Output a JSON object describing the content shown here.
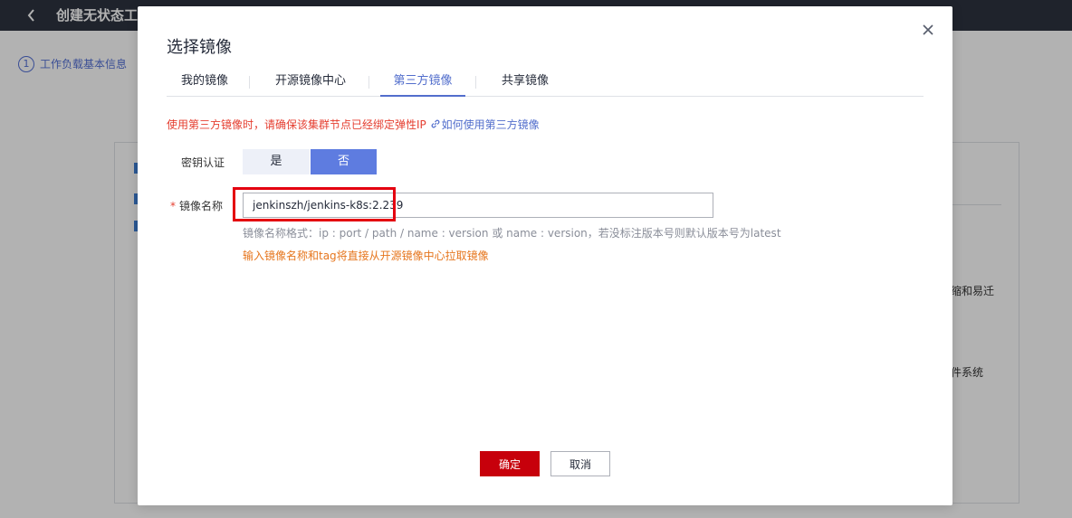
{
  "background": {
    "page_title": "创建无状态工",
    "step_number": "1",
    "step_label": "工作负载基本信息",
    "side_text_1": "缩和易迁",
    "side_text_2": "件系统"
  },
  "modal": {
    "title": "选择镜像",
    "tabs": [
      {
        "label": "我的镜像"
      },
      {
        "label": "开源镜像中心"
      },
      {
        "label": "第三方镜像"
      },
      {
        "label": "共享镜像"
      }
    ],
    "active_tab": "第三方镜像",
    "warning_text": "使用第三方镜像时，请确保该集群节点已经绑定弹性IP",
    "help_link": "如何使用第三方镜像",
    "key_auth": {
      "label": "密钥认证",
      "yes": "是",
      "no": "否",
      "selected": "否"
    },
    "image_name": {
      "required_mark": "*",
      "label": "镜像名称",
      "value": "jenkinszh/jenkins-k8s:2.239"
    },
    "hint_format": "镜像名称格式：ip : port / path / name : version 或 name : version，若没标注版本号则默认版本号为latest",
    "hint_pull": "输入镜像名称和tag将直接从开源镜像中心拉取镜像",
    "ok_label": "确定",
    "cancel_label": "取消"
  },
  "colors": {
    "accent": "#526ecc",
    "primary_button": "#c7000b",
    "warning": "#e53e30",
    "highlight": "#e4000f"
  },
  "icons": [
    "back-icon",
    "close-icon",
    "link-icon"
  ]
}
